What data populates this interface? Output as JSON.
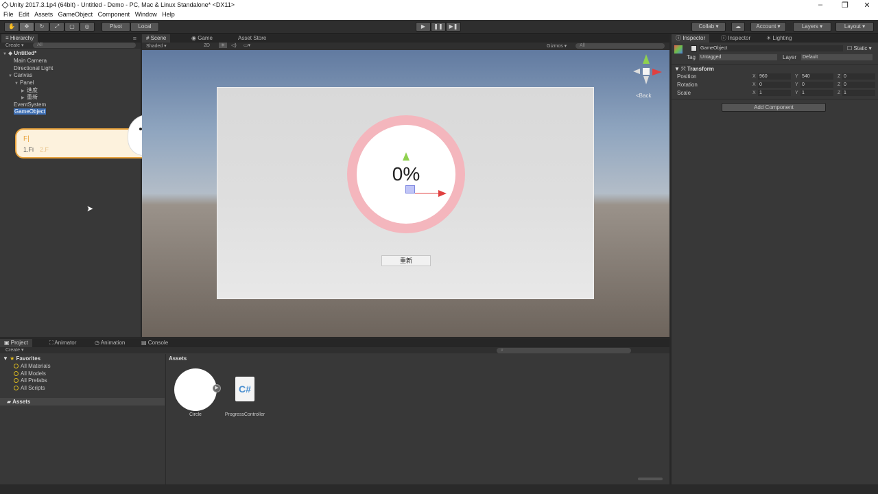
{
  "window": {
    "title": "Unity 2017.3.1p4 (64bit) - Untitled - Demo - PC, Mac & Linux Standalone* <DX11>"
  },
  "menu": [
    "File",
    "Edit",
    "Assets",
    "GameObject",
    "Component",
    "Window",
    "Help"
  ],
  "toolbar": {
    "pivot": "Pivot",
    "local": "Local",
    "collab": "Collab",
    "account": "Account",
    "layers": "Layers",
    "layout": "Layout"
  },
  "hierarchy": {
    "tab": "Hierarchy",
    "create": "Create",
    "search_placeholder": "All",
    "scene_name": "Untitled*",
    "items": [
      {
        "label": "Main Camera"
      },
      {
        "label": "Directional Light"
      },
      {
        "label": "Canvas"
      },
      {
        "label": "Panel"
      },
      {
        "label": "進度"
      },
      {
        "label": "重新"
      },
      {
        "label": "EventSystem"
      },
      {
        "label": "GameObject"
      }
    ]
  },
  "popup": {
    "input": "F|",
    "suggest1": "1.Fi",
    "suggest2": "2.F"
  },
  "scene": {
    "tabs": [
      "Scene",
      "Game",
      "Asset Store"
    ],
    "shading": "Shaded",
    "mode_2d": "2D",
    "gizmos": "Gizmos",
    "search_placeholder": "All",
    "back_label": "Back",
    "progress_text": "0%",
    "progress_value": 0,
    "button_label": "重新",
    "ring_color": "#f4b6bd"
  },
  "inspector": {
    "tabs": [
      "Inspector",
      "Inspector",
      "Lighting"
    ],
    "object_name": "GameObject",
    "static_label": "Static",
    "tag_label": "Tag",
    "tag_value": "Untagged",
    "layer_label": "Layer",
    "layer_value": "Default",
    "component": "Transform",
    "rows": [
      {
        "label": "Position",
        "x": "960",
        "y": "540",
        "z": "0"
      },
      {
        "label": "Rotation",
        "x": "0",
        "y": "0",
        "z": "0"
      },
      {
        "label": "Scale",
        "x": "1",
        "y": "1",
        "z": "1"
      }
    ],
    "add_component": "Add Component"
  },
  "project": {
    "tabs": [
      "Project",
      "Animator",
      "Animation",
      "Console"
    ],
    "create": "Create",
    "favorites": "Favorites",
    "favorite_items": [
      "All Materials",
      "All Models",
      "All Prefabs",
      "All Scripts"
    ],
    "assets_root": "Assets",
    "assets_header": "Assets",
    "assets": [
      {
        "name": "Circle",
        "icon": "circle-sprite-icon"
      },
      {
        "name": "ProgressController",
        "icon": "csharp-script-icon"
      }
    ]
  }
}
